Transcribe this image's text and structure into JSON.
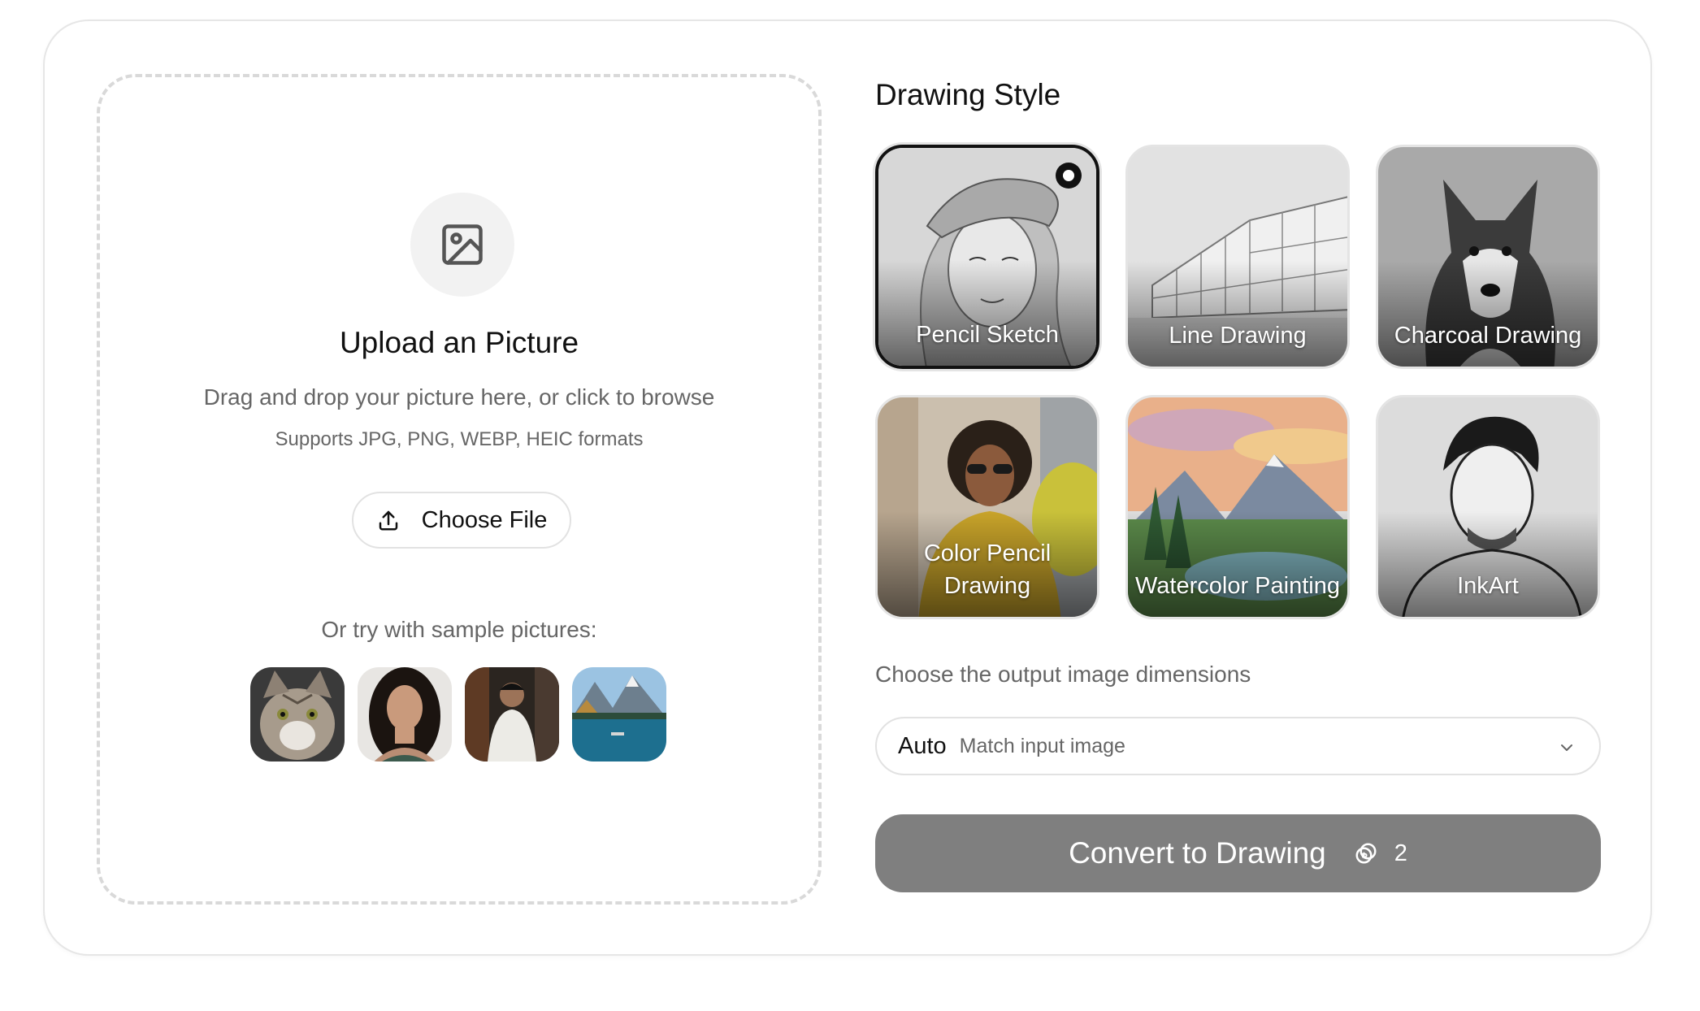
{
  "upload": {
    "title": "Upload an Picture",
    "subtitle": "Drag and drop your picture here, or click to browse",
    "formats": "Supports JPG, PNG, WEBP, HEIC formats",
    "choose_file_label": "Choose File",
    "samples_label": "Or try with sample pictures:",
    "samples": [
      "cat",
      "woman-portrait",
      "man-street",
      "mountain-lake"
    ]
  },
  "drawing_style": {
    "title": "Drawing Style",
    "selected": "Pencil Sketch",
    "options": [
      {
        "label": "Pencil Sketch",
        "icon": "woman-beret-sketch"
      },
      {
        "label": "Line Drawing",
        "icon": "building-line-drawing"
      },
      {
        "label": "Charcoal Drawing",
        "icon": "husky-charcoal"
      },
      {
        "label": "Color Pencil Drawing",
        "icon": "woman-yellow-coat"
      },
      {
        "label": "Watercolor Painting",
        "icon": "mountain-lake-watercolor"
      },
      {
        "label": "InkArt",
        "icon": "man-ink-portrait"
      }
    ]
  },
  "dimensions": {
    "label": "Choose the output image dimensions",
    "value": "Auto",
    "hint": "Match input image"
  },
  "convert": {
    "label": "Convert to Drawing",
    "credits": "2"
  },
  "colors": {
    "button_disabled": "#7f7f7f",
    "border": "#e2e2e2",
    "selected_border": "#111111"
  }
}
